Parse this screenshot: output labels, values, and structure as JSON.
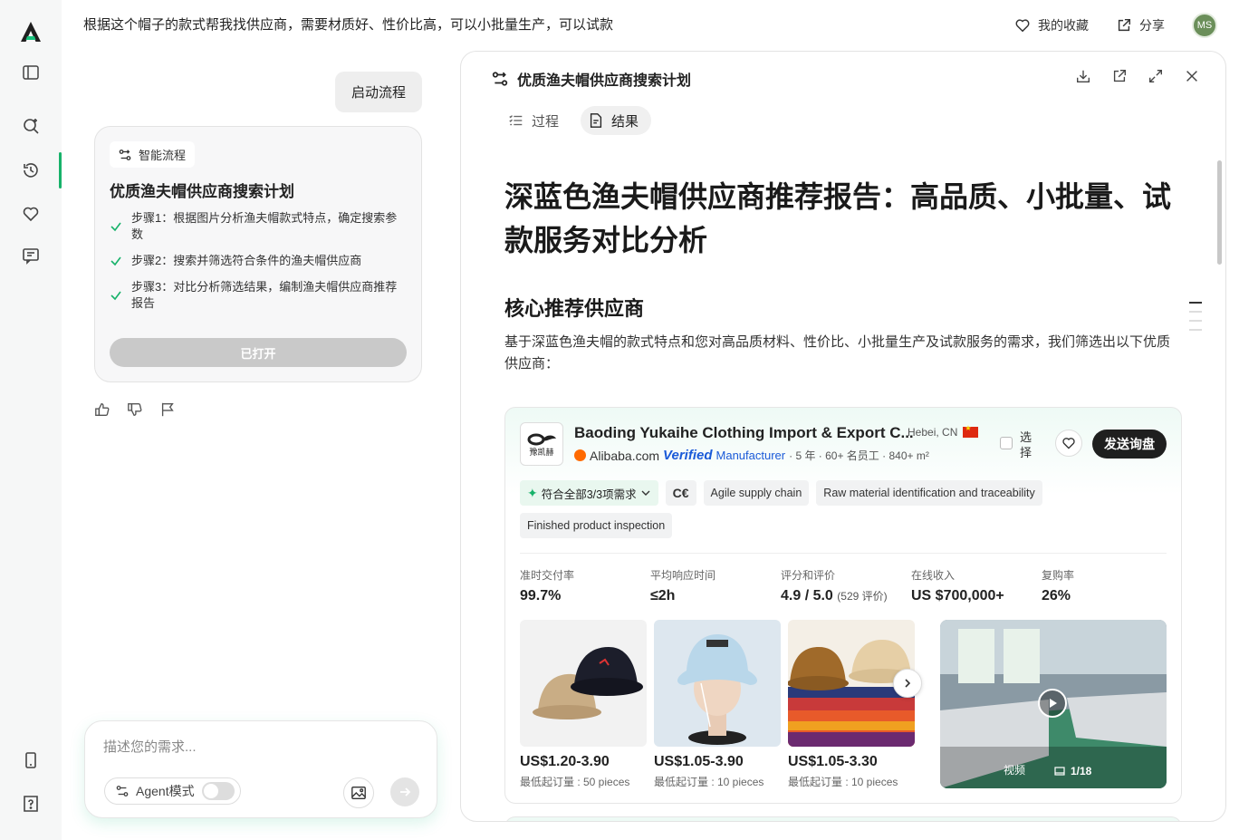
{
  "header": {
    "prompt": "根据这个帽子的款式帮我找供应商，需要材质好、性价比高，可以小批量生产，可以试款",
    "favorites_label": "我的收藏",
    "share_label": "分享",
    "avatar_initials": "MS"
  },
  "chat": {
    "user_message": "启动流程",
    "flow": {
      "chip_label": "智能流程",
      "title": "优质渔夫帽供应商搜索计划",
      "steps": [
        "步骤1：根据图片分析渔夫帽款式特点，确定搜索参数",
        "步骤2：搜索并筛选符合条件的渔夫帽供应商",
        "步骤3：对比分析筛选结果，编制渔夫帽供应商推荐报告"
      ],
      "button_label": "已打开"
    },
    "composer": {
      "placeholder": "描述您的需求...",
      "agent_label": "Agent模式"
    }
  },
  "panel": {
    "title": "优质渔夫帽供应商搜索计划",
    "tabs": [
      {
        "label": "过程",
        "active": false
      },
      {
        "label": "结果",
        "active": true
      }
    ],
    "report_title": "深蓝色渔夫帽供应商推荐报告：高品质、小批量、试款服务对比分析",
    "section_title": "核心推荐供应商",
    "section_body": "基于深蓝色渔夫帽的款式特点和您对高品质材料、性价比、小批量生产及试款服务的需求，我们筛选出以下优质供应商：",
    "supplier": {
      "name": "Baoding Yukaihe Clothing Import & Export C...",
      "location": "Hebei,  CN",
      "platform": "Alibaba.com",
      "verified": "Verified",
      "type": "Manufacturer",
      "stats": "· 5 年 · 60+ 名员工 · 840+ m²",
      "select_label": "选择",
      "inquiry_label": "发送询盘",
      "match_tag": "符合全部3/3项需求",
      "tags": [
        "C€",
        "Agile supply chain",
        "Raw material identification and traceability",
        "Finished product inspection"
      ],
      "metrics": [
        {
          "label": "准时交付率",
          "value": "99.7%",
          "extra": ""
        },
        {
          "label": "平均响应时间",
          "value": "≤2h",
          "extra": ""
        },
        {
          "label": "评分和评价",
          "value": "4.9 / 5.0",
          "extra": "(529 评价)"
        },
        {
          "label": "在线收入",
          "value": "US $700,000+",
          "extra": ""
        },
        {
          "label": "复购率",
          "value": "26%",
          "extra": ""
        }
      ],
      "products": [
        {
          "price": "US$1.20-3.90",
          "moq": "最低起订量 : 50 pieces"
        },
        {
          "price": "US$1.05-3.90",
          "moq": "最低起订量 : 10 pieces"
        },
        {
          "price": "US$1.05-3.30",
          "moq": "最低起订量 : 10 pieces"
        }
      ],
      "video_label": "视频",
      "video_count": "1/18"
    }
  }
}
